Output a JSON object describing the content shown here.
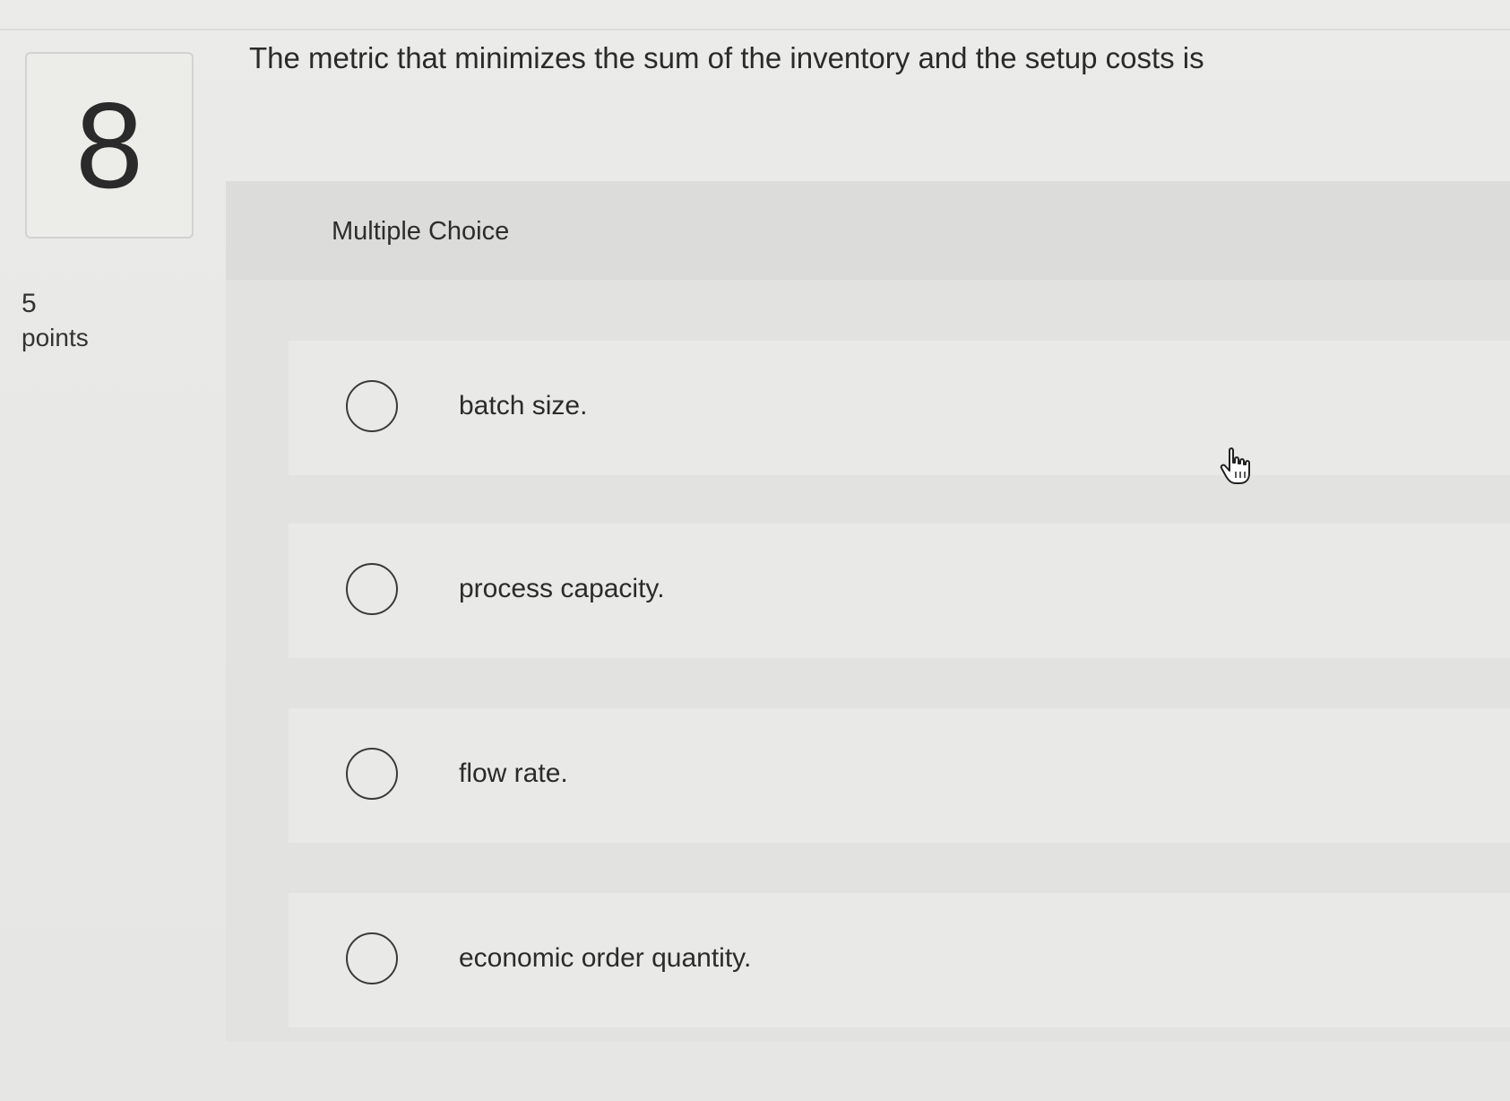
{
  "question": {
    "number": "8",
    "points_value": "5",
    "points_label": "points",
    "text": "The metric that minimizes the sum of the inventory and the setup costs is"
  },
  "choices": {
    "header": "Multiple Choice",
    "options": [
      {
        "label": "batch size."
      },
      {
        "label": "process capacity."
      },
      {
        "label": "flow rate."
      },
      {
        "label": "economic order quantity."
      }
    ]
  },
  "icons": {
    "cursor": "hand-pointer-icon"
  }
}
